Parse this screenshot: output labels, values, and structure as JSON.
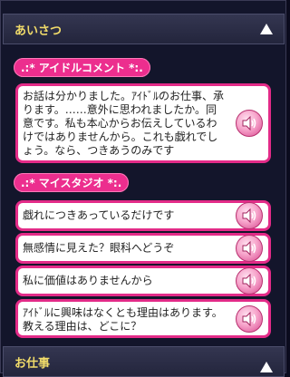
{
  "greeting_section": {
    "title": "あいさつ"
  },
  "idol_comment": {
    "label": ".:* アイドルコメント *:.",
    "text": "お話は分かりました。ｱｲﾄﾞﾙのお仕事、承ります。……意外に思われましたか。同意です。私も本心からお伝えしているわけではありませんから。これも戯れでしょう。なら、つきあうのみです"
  },
  "my_studio": {
    "label": ".:* マイスタジオ *:.",
    "lines": [
      "戯れにつきあっているだけです",
      "無感情に見えた？眼科へどうぞ",
      "私に価値はありませんから",
      "ｱｲﾄﾞﾙに興味はなくとも理由はあります。教える理由は、どこに？"
    ]
  },
  "work_section": {
    "title": "お仕事"
  },
  "icons": {
    "voice": "speaker-icon",
    "collapse": "triangle-up-icon"
  },
  "colors": {
    "accent_pink": "#e32b88",
    "header_gold": "#f2dc6a",
    "panel_bg": "#13152b"
  }
}
